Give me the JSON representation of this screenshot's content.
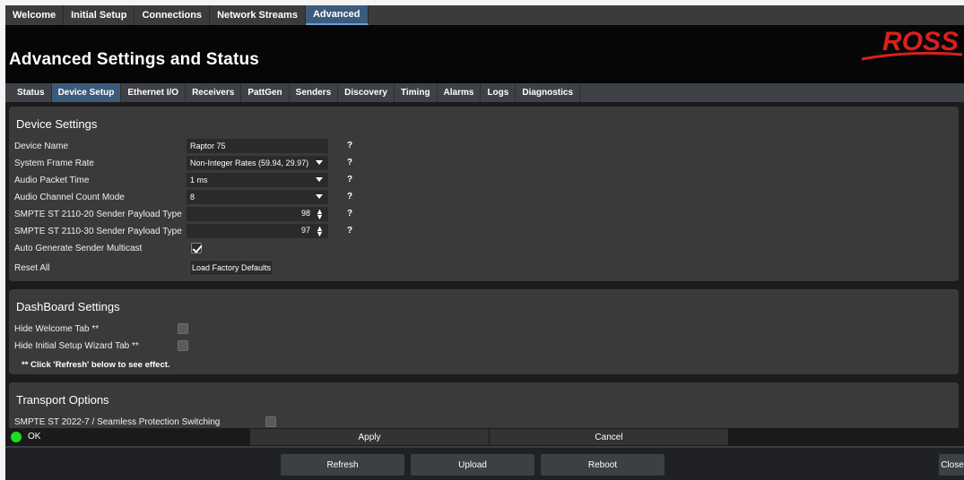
{
  "top_tabs": [
    "Welcome",
    "Initial Setup",
    "Connections",
    "Network Streams",
    "Advanced"
  ],
  "header": {
    "title": "Advanced Settings and Status",
    "logo_text": "ROSS",
    "logo_color": "#d9201e"
  },
  "sub_tabs": [
    "Status",
    "Device Setup",
    "Ethernet I/O",
    "Receivers",
    "PattGen",
    "Senders",
    "Discovery",
    "Timing",
    "Alarms",
    "Logs",
    "Diagnostics"
  ],
  "active_sub_tab": "Device Setup",
  "device_settings": {
    "title": "Device Settings",
    "device_name_label": "Device Name",
    "device_name_value": "Raptor 75",
    "frame_rate_label": "System Frame Rate",
    "frame_rate_value": "Non-Integer Rates (59.94, 29.97)",
    "audio_packet_label": "Audio Packet Time",
    "audio_packet_value": "1 ms",
    "channel_count_label": "Audio Channel Count Mode",
    "channel_count_value": "8",
    "st2110_20_label": "SMPTE ST 2110-20 Sender Payload Type",
    "st2110_20_value": "98",
    "st2110_30_label": "SMPTE ST 2110-30 Sender Payload Type",
    "st2110_30_value": "97",
    "auto_multicast_label": "Auto Generate Sender Multicast",
    "auto_multicast_checked": true,
    "reset_label": "Reset All",
    "reset_button": "Load Factory Defaults",
    "help": "?"
  },
  "dashboard_settings": {
    "title": "DashBoard Settings",
    "hide_welcome_label": "Hide Welcome Tab **",
    "hide_welcome_checked": false,
    "hide_wizard_label": "Hide Initial Setup Wizard Tab **",
    "hide_wizard_checked": false,
    "note": "** Click 'Refresh' below to see effect."
  },
  "transport_options": {
    "title": "Transport Options",
    "st2022_label": "SMPTE ST 2022-7 / Seamless Protection Switching",
    "st2022_checked": false
  },
  "status": {
    "text": "OK",
    "color": "#1fdc1f"
  },
  "apply_button": "Apply",
  "cancel_button": "Cancel",
  "bottom": {
    "refresh": "Refresh",
    "upload": "Upload",
    "reboot": "Reboot",
    "close": "Close"
  }
}
